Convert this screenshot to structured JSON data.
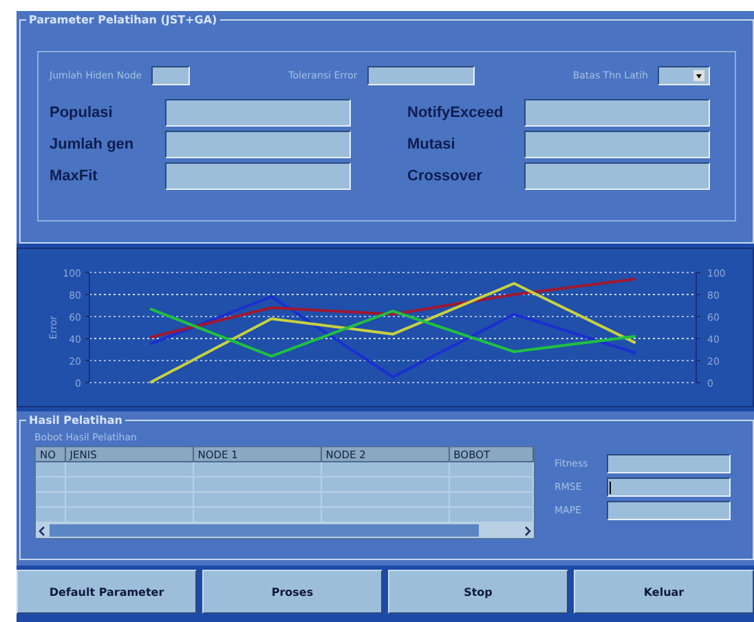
{
  "parameter_panel": {
    "title": "Parameter Pelatihan (JST+GA)",
    "top_fields": [
      {
        "label": "Jumlah Hiden Node",
        "kind": "short"
      },
      {
        "label": "Toleransi Error",
        "kind": "text"
      },
      {
        "label": "Batas Thn Latih",
        "kind": "dropdown"
      }
    ],
    "left_fields": [
      {
        "label": "Populasi"
      },
      {
        "label": "Jumlah gen"
      },
      {
        "label": "MaxFit"
      }
    ],
    "right_fields": [
      {
        "label": "NotifyExceed"
      },
      {
        "label": "Mutasi"
      },
      {
        "label": "Crossover"
      }
    ]
  },
  "chart_panel": {
    "chart_data": {
      "type": "line",
      "ylabel": "Error",
      "grid": true,
      "ylim": [
        0,
        100
      ],
      "yticks": [
        0,
        20,
        40,
        60,
        80,
        100
      ],
      "series": [
        {
          "color": "#1a2fd0",
          "values": [
            35,
            78,
            5,
            62,
            27
          ]
        },
        {
          "color": "#a01830",
          "values": [
            41,
            68,
            62,
            80,
            94
          ]
        },
        {
          "color": "#c8d040",
          "values": [
            0,
            58,
            44,
            90,
            36
          ]
        },
        {
          "color": "#20c040",
          "values": [
            67,
            24,
            65,
            28,
            42
          ]
        }
      ]
    },
    "right_yticks": [
      "100",
      "80",
      "60",
      "40",
      "20",
      "0"
    ]
  },
  "results_panel": {
    "title": "Hasil Pelatihan",
    "table_title": "Bobot Hasil Pelatihan",
    "table": {
      "columns": [
        "NO",
        "JENIS",
        "NODE 1",
        "NODE 2",
        "BOBOT"
      ]
    },
    "metrics": [
      {
        "label": "Fitness",
        "focused": false
      },
      {
        "label": "RMSE",
        "focused": true
      },
      {
        "label": "MAPE",
        "focused": false
      }
    ]
  },
  "buttons": [
    "Default Parameter",
    "Proses",
    "Stop",
    "Keluar"
  ]
}
